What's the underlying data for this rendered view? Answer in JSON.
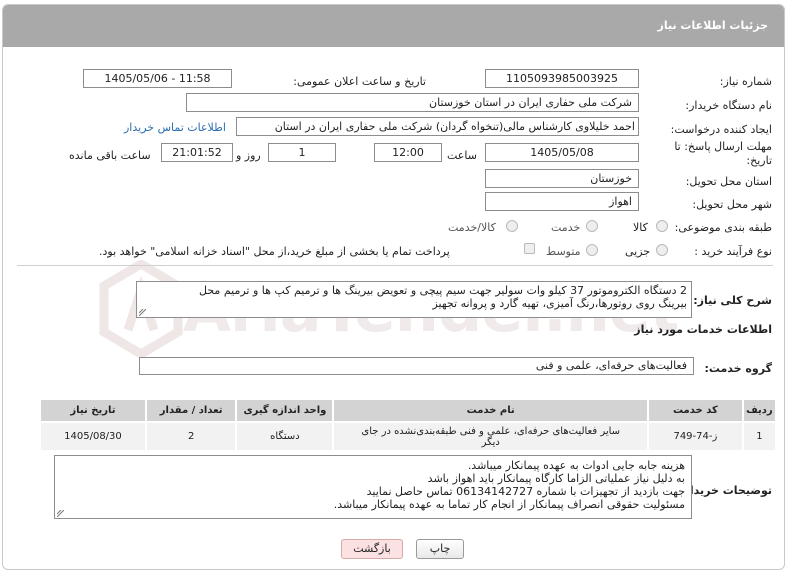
{
  "header": {
    "title": "جزئیات اطلاعات نیاز"
  },
  "form": {
    "need_number_label": "شماره نیاز:",
    "need_number": "1105093985003925",
    "announce_label": "تاریخ و ساعت اعلان عمومی:",
    "announce_value": "1405/05/06 - 11:58",
    "buyer_label": "نام دستگاه خریدار:",
    "buyer_value": "شرکت ملی حفاری ایران در استان خوزستان",
    "creator_label": "ایجاد کننده درخواست:",
    "creator_value": "احمد خلیلاوی کارشناس مالی(تنخواه گردان) شرکت ملی حفاری ایران در استان",
    "contact_link": "اطلاعات تماس خریدار",
    "deadline_label": "مهلت ارسال پاسخ: تا تاریخ:",
    "deadline_date": "1405/05/08",
    "time_label": "ساعت",
    "deadline_time": "12:00",
    "days_value": "1",
    "days_label": "روز و",
    "remaining_time": "21:01:52",
    "remaining_label": "ساعت باقی مانده",
    "province_label": "استان محل تحویل:",
    "province_value": "خوزستان",
    "city_label": "شهر محل تحویل:",
    "city_value": "اهواز",
    "category_label": "طبقه بندی موضوعی:",
    "category_options": [
      "کالا",
      "خدمت",
      "کالا/خدمت"
    ],
    "process_label": "نوع فرآیند خرید :",
    "process_options": [
      "جزیی",
      "متوسط"
    ],
    "payment_note": "پرداخت تمام یا بخشی از مبلغ خرید،از محل \"اسناد خزانه اسلامی\" خواهد بود."
  },
  "summary": {
    "label": "شرح کلی نیاز:",
    "text_line1": "2 دستگاه الکتروموتور 37 کیلو وات سولیر جهت سیم پیچی و تعویض بیرینگ ها و ترمیم کپ ها و ترمیم محل",
    "text_line2": "بیرینگ روی روتورها،رنگ آمیزی، تهیه گارد و پروانه تجهیز"
  },
  "services": {
    "section_title": "اطلاعات خدمات مورد نیاز",
    "group_label": "گروه خدمت:",
    "group_value": "فعالیت‌های حرفه‌ای، علمی و فنی"
  },
  "table": {
    "headers": [
      "ردیف",
      "کد خدمت",
      "نام خدمت",
      "واحد اندازه گیری",
      "تعداد / مقدار",
      "تاریخ نیاز"
    ],
    "rows": [
      {
        "row": "1",
        "code": "ز-74-749",
        "name_line1": "سایر فعالیت‌های حرفه‌ای، علمی و فنی طبقه‌بندی‌نشده در جای",
        "name_line2": "دیگر",
        "unit": "دستگاه",
        "qty": "2",
        "date": "1405/08/30"
      }
    ]
  },
  "notes": {
    "label": "توضیحات خریدار:",
    "lines": [
      "هزینه جابه جایی ادوات به عهده پیمانکار میباشد.",
      "به دلیل نیاز عملیاتی الزاما کارگاه پیمانکار باید اهواز باشد",
      "جهت بازدید از تجهیزات با شماره 06134142727 تماس حاصل نمایید",
      "مسئولیت حقوقی انصراف پیمانکار از انجام کار تماما به عهده پیمانکار میباشد."
    ]
  },
  "buttons": {
    "print": "چاپ",
    "back": "بازگشت"
  },
  "watermark": {
    "text": "AriaTender.net"
  },
  "colors": {
    "header_bg": "#a9a9a9",
    "link": "#2a6db0",
    "back_btn": "#fbe1e1"
  }
}
